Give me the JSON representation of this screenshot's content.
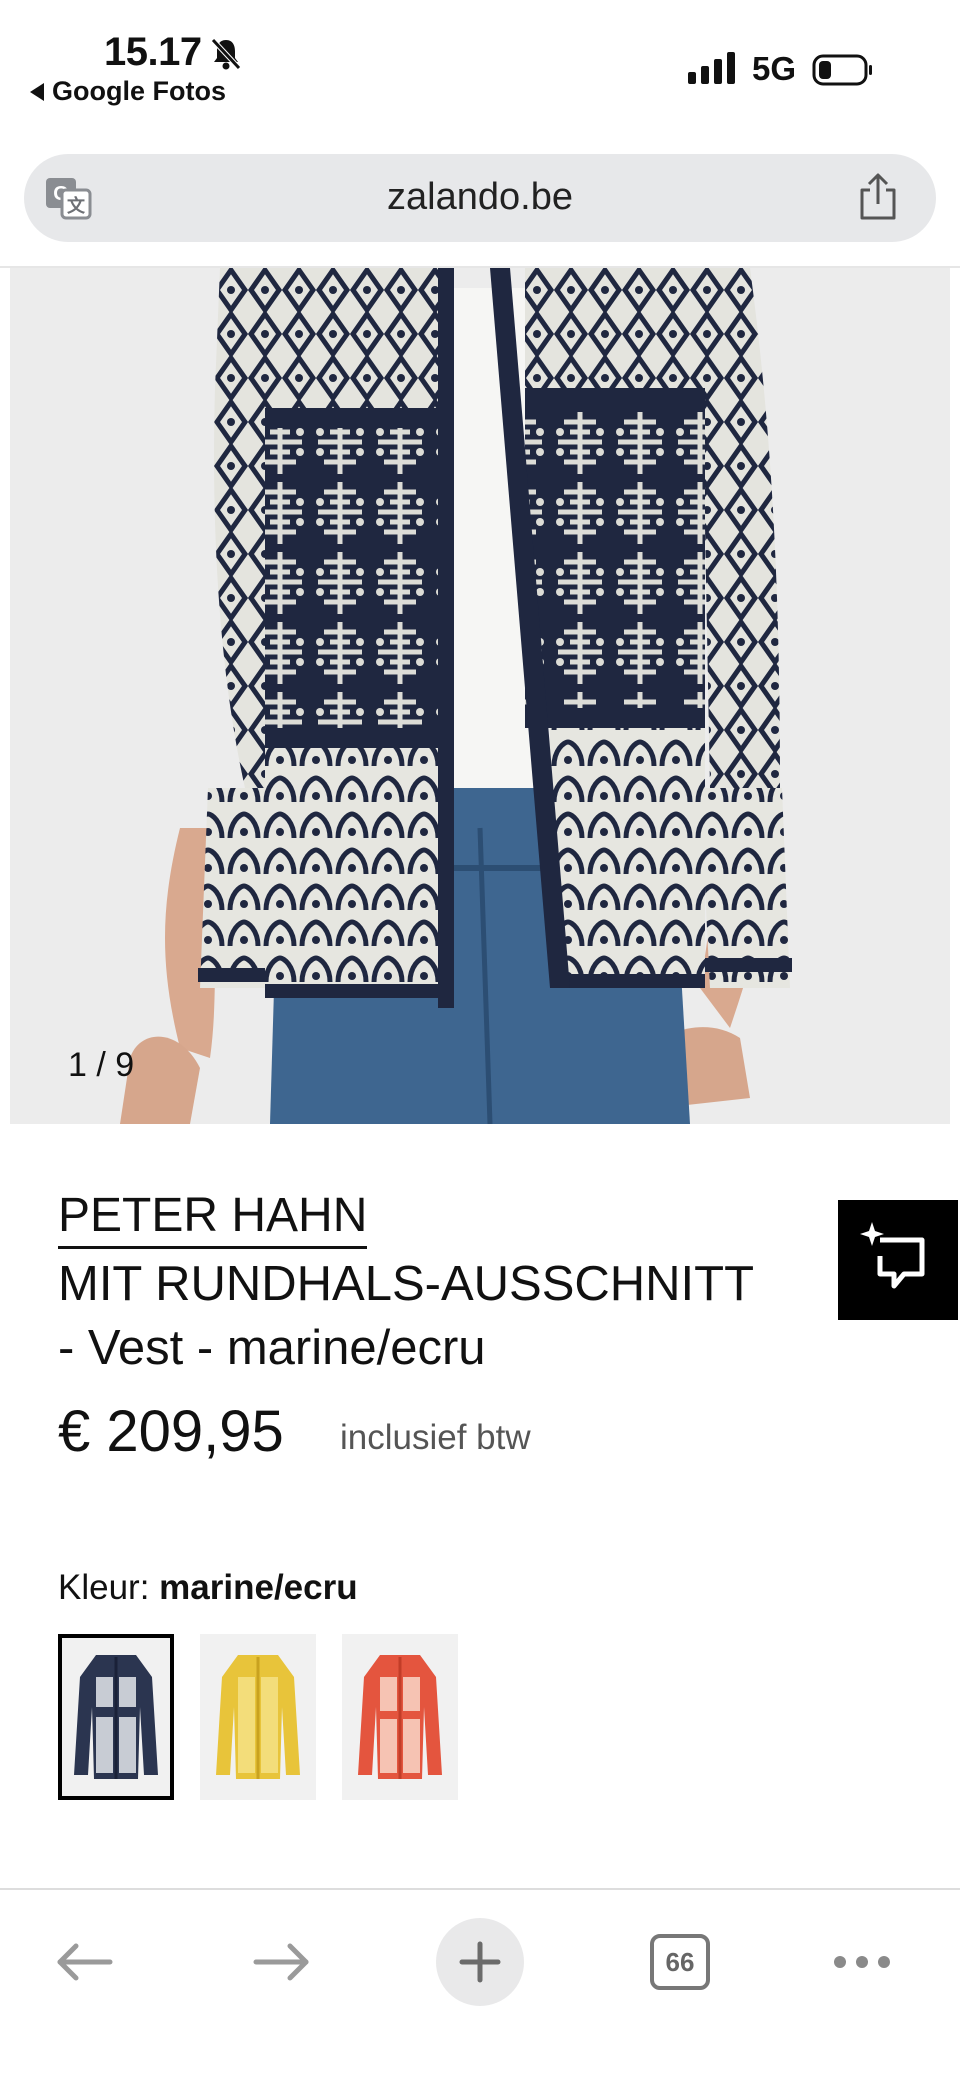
{
  "status_bar": {
    "time": "15.17",
    "back_app": "Google Fotos",
    "network": "5G"
  },
  "url_bar": {
    "url": "zalando.be"
  },
  "product": {
    "image_counter": "1 / 9",
    "brand": "PETER HAHN",
    "title": "MIT RUNDHALS-AUSSCHNITT\n- Vest - marine/ecru",
    "price": "€ 209,95",
    "price_note": "inclusief btw",
    "color_label": "Kleur:",
    "color_value": "marine/ecru",
    "swatches": [
      {
        "color": "marine/ecru",
        "fill": "#2b3550",
        "accent": "#d9dde3",
        "selected": true
      },
      {
        "color": "geel",
        "fill": "#e8c43a",
        "accent": "#f3dd7a",
        "selected": false
      },
      {
        "color": "rood",
        "fill": "#e4553e",
        "accent": "#f6c3b3",
        "selected": false
      }
    ]
  },
  "toolbar": {
    "tab_count": "66"
  },
  "colors": {
    "navy": "#1e2740",
    "ecru": "#e6e6e0",
    "denim": "#3a5f86",
    "url_bar_bg": "#e7e8ea"
  }
}
